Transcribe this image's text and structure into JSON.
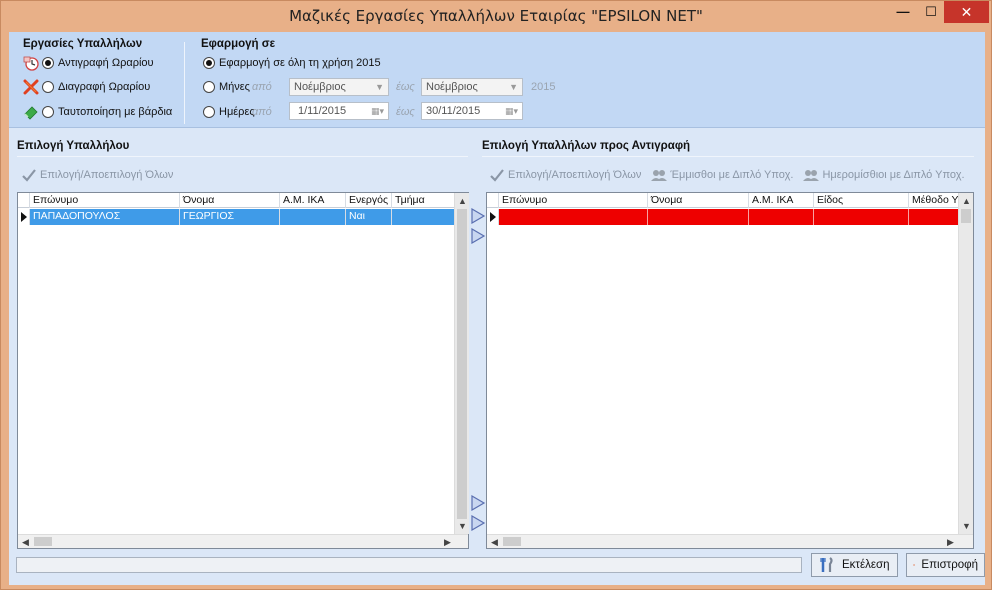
{
  "window": {
    "title": "Μαζικές Εργασίες Υπαλλήλων Εταιρίας \"EPSILON NET\"",
    "min_glyph": "—",
    "max_glyph": "☐",
    "close_glyph": "✕"
  },
  "operations": {
    "title": "Εργασίες Υπαλλήλων",
    "items": [
      {
        "label": "Αντιγραφή Ωραρίου",
        "selected": true,
        "icon": "clock-copy-icon"
      },
      {
        "label": "Διαγραφή Ωραρίου",
        "selected": false,
        "icon": "delete-x-icon"
      },
      {
        "label": "Ταυτοποίηση με βάρδια",
        "selected": false,
        "icon": "eraser-icon"
      }
    ]
  },
  "apply": {
    "title": "Εφαρμογή σε",
    "whole_year_label": "Εφαρμογή σε όλη τη χρήση 2015",
    "months_label": "Μήνες",
    "days_label": "Ημέρες",
    "from_label": "από",
    "to_label": "έως",
    "month_from": "Νοέμβριος",
    "month_to": "Νοέμβριος",
    "year": "2015",
    "date_from": "1/11/2015",
    "date_to": "30/11/2015"
  },
  "left_panel": {
    "title": "Επιλογή Υπαλλήλου",
    "toolbar_select_all": "Επιλογή/Αποεπιλογή Όλων",
    "columns": [
      "Επώνυμο",
      "Όνομα",
      "Α.Μ. ΙΚΑ",
      "Ενεργός",
      "Τμήμα"
    ],
    "rows": [
      [
        "ΠΑΠΑΔΟΠΟΥΛΟΣ",
        "ΓΕΩΡΓΙΟΣ",
        "",
        "Ναι",
        ""
      ]
    ]
  },
  "right_panel": {
    "title": "Επιλογή Υπαλλήλων προς Αντιγραφή",
    "toolbar_select_all": "Επιλογή/Αποεπιλογή Όλων",
    "toolbar_salaried": "Έμμισθοι με Διπλό Υποχ.",
    "toolbar_daily": "Ημερομίσθιοι με Διπλό Υποχ.",
    "columns": [
      "Επώνυμο",
      "Όνομα",
      "Α.Μ. ΙΚΑ",
      "Είδος",
      "Μέθοδο Υ"
    ],
    "rows": [
      [
        "",
        "",
        "",
        "",
        ""
      ]
    ]
  },
  "buttons": {
    "execute": "Εκτέλεση",
    "return": "Επιστροφή"
  },
  "colors": {
    "selected_row": "#3f9be8",
    "error_row": "#ee0000",
    "frame": "#e8b088"
  }
}
